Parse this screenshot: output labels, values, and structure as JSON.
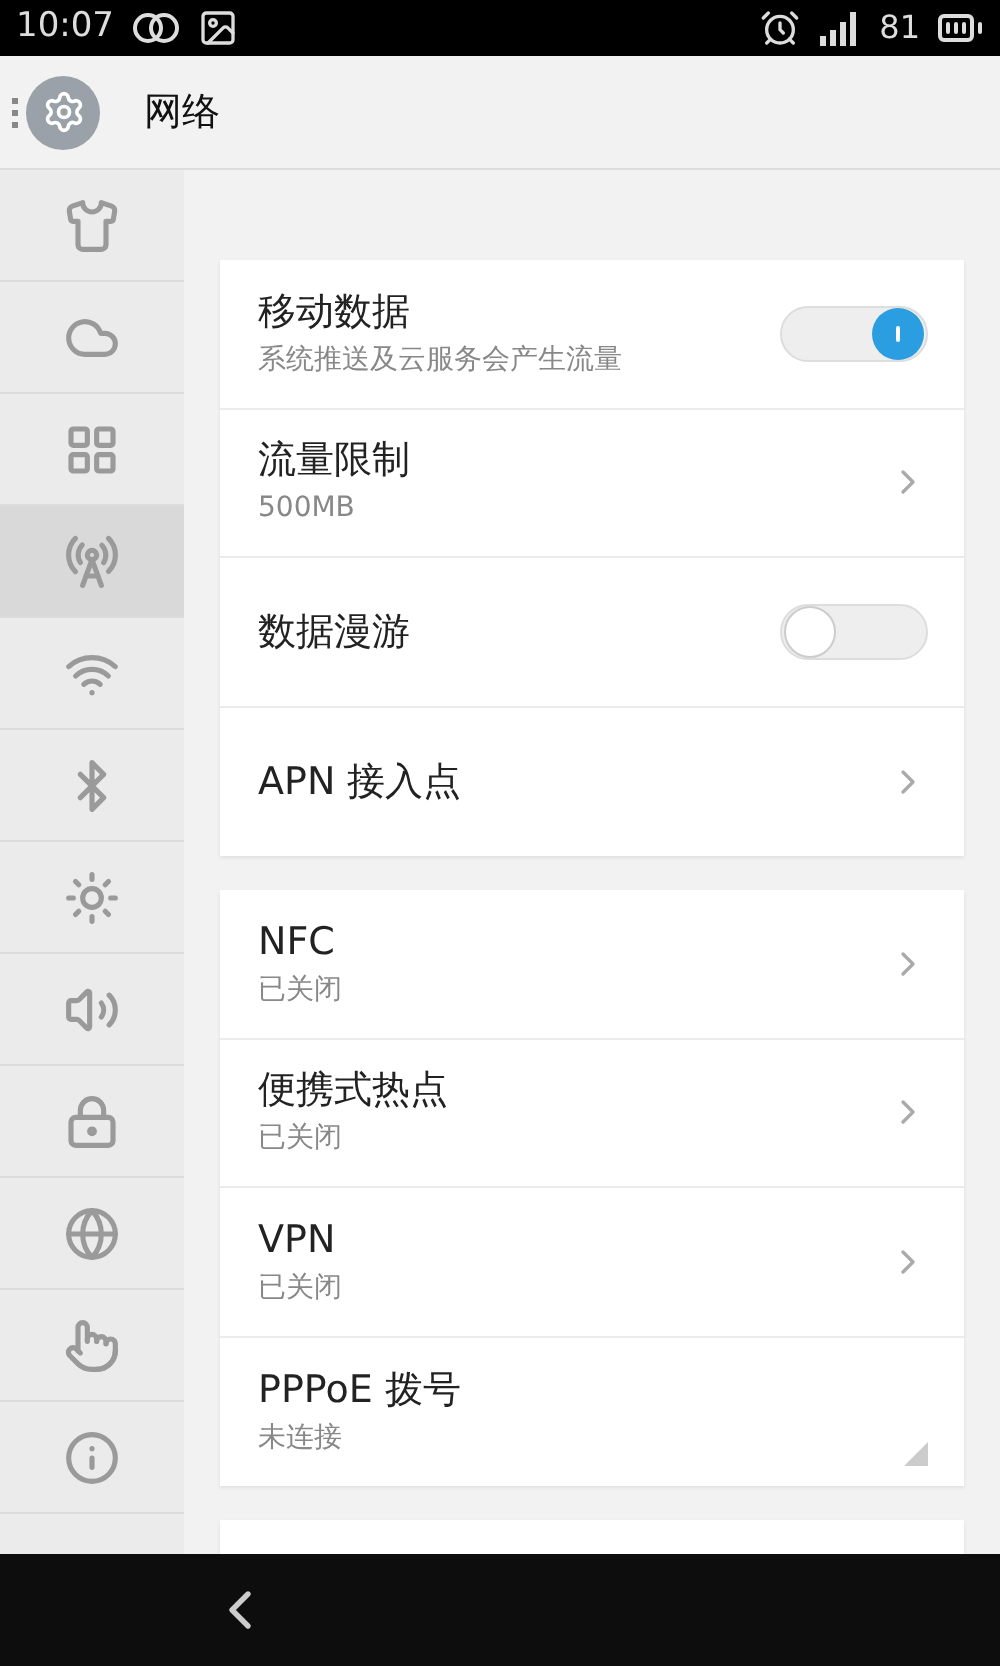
{
  "status_bar": {
    "time": "10:07",
    "battery": "81"
  },
  "header": {
    "title": "网络"
  },
  "sidebar": {
    "items": [
      {
        "kind": "theme",
        "selected": false
      },
      {
        "kind": "cloud",
        "selected": false
      },
      {
        "kind": "apps",
        "selected": false
      },
      {
        "kind": "network",
        "selected": true
      },
      {
        "kind": "wifi",
        "selected": false
      },
      {
        "kind": "bluetooth",
        "selected": false
      },
      {
        "kind": "display",
        "selected": false
      },
      {
        "kind": "sound",
        "selected": false
      },
      {
        "kind": "security",
        "selected": false
      },
      {
        "kind": "language",
        "selected": false
      },
      {
        "kind": "gesture",
        "selected": false
      },
      {
        "kind": "about",
        "selected": false
      }
    ]
  },
  "groups": [
    {
      "rows": [
        {
          "kind": "toggle",
          "title": "移动数据",
          "subtitle": "系统推送及云服务会产生流量",
          "on": true
        },
        {
          "kind": "link",
          "title": "流量限制",
          "subtitle": "500MB"
        },
        {
          "kind": "toggle",
          "title": "数据漫游",
          "on": false
        },
        {
          "kind": "link",
          "title": "APN 接入点"
        }
      ]
    },
    {
      "rows": [
        {
          "kind": "link",
          "title": "NFC",
          "subtitle": "已关闭"
        },
        {
          "kind": "link",
          "title": "便携式热点",
          "subtitle": "已关闭"
        },
        {
          "kind": "link",
          "title": "VPN",
          "subtitle": "已关闭"
        },
        {
          "kind": "corner",
          "title": "PPPoE 拨号",
          "subtitle": "未连接"
        }
      ]
    },
    {
      "kind": "cut-off"
    }
  ]
}
